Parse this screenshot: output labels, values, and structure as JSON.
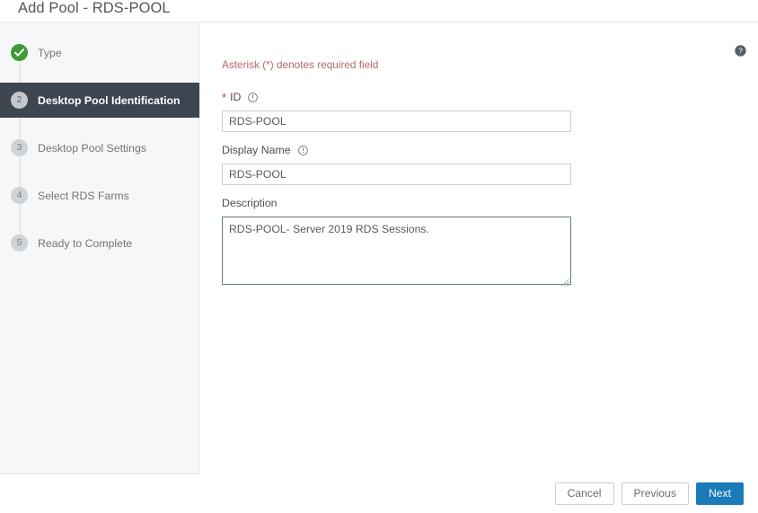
{
  "header": {
    "title": "Add Pool - RDS-POOL"
  },
  "sidebar": {
    "steps": [
      {
        "number": "1",
        "label": "Type",
        "state": "done"
      },
      {
        "number": "2",
        "label": "Desktop Pool Identification",
        "state": "current"
      },
      {
        "number": "3",
        "label": "Desktop Pool Settings",
        "state": "upcoming"
      },
      {
        "number": "4",
        "label": "Select RDS Farms",
        "state": "upcoming"
      },
      {
        "number": "5",
        "label": "Ready to Complete",
        "state": "upcoming"
      }
    ]
  },
  "content": {
    "required_note": "Asterisk (*) denotes required field",
    "help_icon": "help-circle-icon",
    "fields": {
      "id": {
        "label": "ID",
        "required_marker": "*",
        "info_icon": "info-circle-icon",
        "value": "RDS-POOL",
        "placeholder": ""
      },
      "display_name": {
        "label": "Display Name",
        "info_icon": "info-circle-icon",
        "value": "RDS-POOL",
        "placeholder": ""
      },
      "description": {
        "label": "Description",
        "value": "RDS-POOL- Server 2019 RDS Sessions.",
        "placeholder": ""
      }
    }
  },
  "footer": {
    "cancel_label": "Cancel",
    "previous_label": "Previous",
    "next_label": "Next"
  },
  "colors": {
    "accent_blue": "#1a7bb9",
    "success_green": "#3d9c33",
    "active_step_bg": "#3d4551",
    "required_red": "#b5666e",
    "focus_border": "#5d7f87"
  }
}
